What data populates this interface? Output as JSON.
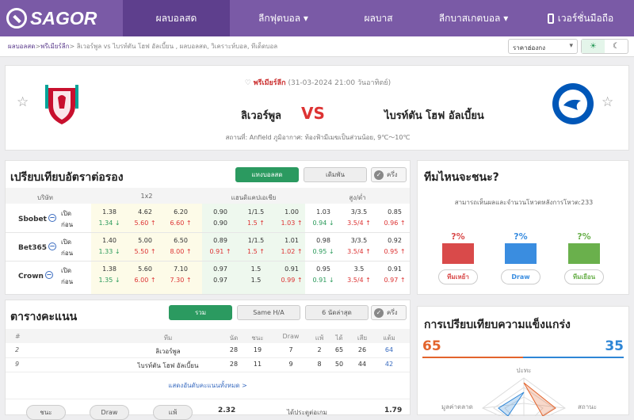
{
  "nav": {
    "logo": "SAGOR",
    "items": [
      "ผลบอลสด",
      "ลีกฟุตบอล ▾",
      "ผลบาส",
      "ลีกบาสเกตบอล ▾",
      "เวอร์ชั่นมือถือ"
    ]
  },
  "breadcrumb": {
    "home": "ผลบอลสด",
    "sep1": " > ",
    "league": "พรีเมียร์ลีก",
    "rest": " > ลิเวอร์พูล vs  ไบรท์ตัน โฮฟ อัลเบี้ยน ,  ผลบอลสด,  วิเคราะห์บอล,  ทีเด็ดบอล"
  },
  "region_select": "ราคาฮ่องกง",
  "match": {
    "league": "พรีเมียร์ลีก",
    "datetime": " (31-03-2024 21:00 วันอาทิตย์)",
    "home": "ลิเวอร์พูล",
    "away": "ไบรท์ตัน โฮฟ อัลเบี้ยน",
    "vs": "VS",
    "venue": "สถานที่: Anfield      ภูมิอากาศ: ท้องฟ้ามีเมฆเป็นส่วนน้อย, 9℃～10℃"
  },
  "odds": {
    "title": "เปรียบเทียบอัตราต่อรอง",
    "tabs": [
      "แทงบอลสด",
      "เดิมพัน"
    ],
    "half": "ครึ่ง",
    "headers": [
      "บริษัท",
      "1x2",
      "แฮนดิแคปเอเชีย",
      "สูง/ต่ำ"
    ],
    "row_labels": [
      "เปิด",
      "ก่อน"
    ],
    "books": [
      {
        "name": "Sbobet",
        "open": [
          "1.38",
          "4.62",
          "6.20",
          "0.90",
          "1/1.5",
          "1.00",
          "1.03",
          "3/3.5",
          "0.85"
        ],
        "pre": [
          "1.34",
          "5.60",
          "6.60",
          "0.90",
          "1.5",
          "1.03",
          "0.94",
          "3.5/4",
          "0.96"
        ],
        "pre_dir": [
          "dn",
          "up",
          "up",
          "",
          "up",
          "up",
          "dn",
          "up",
          "up"
        ]
      },
      {
        "name": "Bet365",
        "open": [
          "1.40",
          "5.00",
          "6.50",
          "0.89",
          "1/1.5",
          "1.01",
          "0.98",
          "3/3.5",
          "0.92"
        ],
        "pre": [
          "1.33",
          "5.50",
          "8.00",
          "0.91",
          "1.5",
          "1.02",
          "0.95",
          "3.5/4",
          "0.95"
        ],
        "pre_dir": [
          "dn",
          "up",
          "up",
          "up",
          "up",
          "up",
          "dn",
          "up",
          "up"
        ]
      },
      {
        "name": "Crown",
        "open": [
          "1.38",
          "5.60",
          "7.10",
          "0.97",
          "1.5",
          "0.91",
          "0.95",
          "3.5",
          "0.91"
        ],
        "pre": [
          "1.35",
          "6.00",
          "7.30",
          "0.97",
          "1.5",
          "0.99",
          "0.91",
          "3.5/4",
          "0.97"
        ],
        "pre_dir": [
          "dn",
          "up",
          "up",
          "",
          "",
          "up",
          "dn",
          "up",
          "up"
        ]
      }
    ]
  },
  "vote": {
    "title": "ทีมไหนจะชนะ?",
    "subtitle": "สามารถเห็นผลและจำนวนโหวตหลังการโหวต:233",
    "pcts": [
      "?%",
      "?%",
      "?%"
    ],
    "buttons": [
      "ทีมเหย้า",
      "Draw",
      "ทีมเยือน"
    ],
    "colors": [
      "#d94a4a",
      "#3a8de0",
      "#6ab04c"
    ]
  },
  "table": {
    "title": "ตารางคะแนน",
    "tabs": [
      "รวม",
      "Same H/A",
      "6 นัดล่าสุด"
    ],
    "half": "ครึ่ง",
    "headers": [
      "#",
      "ทีม",
      "นัด",
      "ชนะ",
      "Draw",
      "แพ้",
      "ได้",
      "เสีย",
      "แต้ม"
    ],
    "rows": [
      [
        "2",
        "ลิเวอร์พูล",
        "28",
        "19",
        "7",
        "2",
        "65",
        "26",
        "64"
      ],
      [
        "9",
        "ไบรท์ตัน โฮฟ อัลเบี้ยน",
        "28",
        "11",
        "9",
        "8",
        "50",
        "44",
        "42"
      ]
    ],
    "more": "แสดงอันดับคะแนนทั้งหมด >"
  },
  "stats": {
    "labels": [
      "ชนะ",
      "Draw",
      "แพ้"
    ],
    "v1": "2.32",
    "goal_label": "ได้ประตูต่อเกม",
    "v2": "1.79"
  },
  "strength": {
    "title": "การเปรียบเทียบความแข็งแกร่ง",
    "home": "65",
    "away": "35",
    "axis_top": "ปะทะ",
    "axis_left": "มูลค่าตลาด",
    "axis_right": "สถานะ"
  }
}
